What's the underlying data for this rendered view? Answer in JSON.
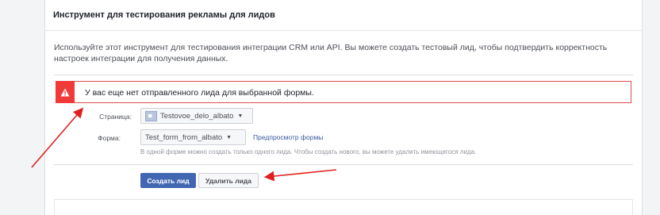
{
  "header": {
    "title": "Инструмент для тестирования рекламы для лидов"
  },
  "description": "Используйте этот инструмент для тестирования интеграции CRM или API. Вы можете создать тестовый лид, чтобы подтвердить корректность настроек интеграции для получения данных.",
  "alert": {
    "icon": "warning-icon",
    "color": "#f03a3a",
    "text": "У вас еще нет отправленного лида для выбранной формы."
  },
  "form": {
    "page_label": "Страница:",
    "page_value": "Testovoe_delo_albato",
    "form_label": "Форма:",
    "form_value": "Test_form_from_albato",
    "preview_link": "Предпросмотр формы",
    "hint": "В одной форме можно создать только одного лида. Чтобы создать нового, вы можете удалить имеющегося лида."
  },
  "actions": {
    "create_label": "Создать лид",
    "delete_label": "Удалить лида"
  },
  "colors": {
    "primary": "#4267b2",
    "link": "#365899",
    "annotation_arrow": "#e02020"
  }
}
